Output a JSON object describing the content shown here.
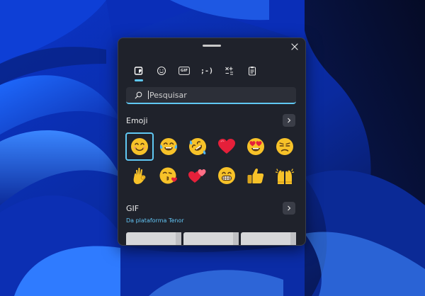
{
  "window": {
    "close_icon": "close-icon"
  },
  "tabs": [
    {
      "name": "recent-icon",
      "label": ""
    },
    {
      "name": "smiley-icon",
      "label": ""
    },
    {
      "name": "gif-icon",
      "label": "GIF"
    },
    {
      "name": "kaomoji-icon",
      "label": ";-)"
    },
    {
      "name": "symbols-icon",
      "label": ""
    },
    {
      "name": "clipboard-icon",
      "label": ""
    }
  ],
  "search": {
    "placeholder": "Pesquisar",
    "icon": "search-icon"
  },
  "emoji_section": {
    "title": "Emoji",
    "more_icon": "chevron-right-icon",
    "items": [
      "smiling-face",
      "tears-of-joy",
      "rolling-laughing",
      "red-heart",
      "heart-eyes",
      "unamused-face",
      "ok-hand",
      "face-blowing-kiss",
      "two-hearts",
      "grinning-face",
      "thumbs-up",
      "raising-hands"
    ]
  },
  "gif_section": {
    "title": "GIF",
    "more_icon": "chevron-right-icon",
    "source": "Da plataforma Tenor"
  },
  "colors": {
    "accent": "#60c8f3",
    "panel": "#1f222b",
    "emoji_yellow": "#f7c229",
    "heart_red": "#e5203a"
  }
}
